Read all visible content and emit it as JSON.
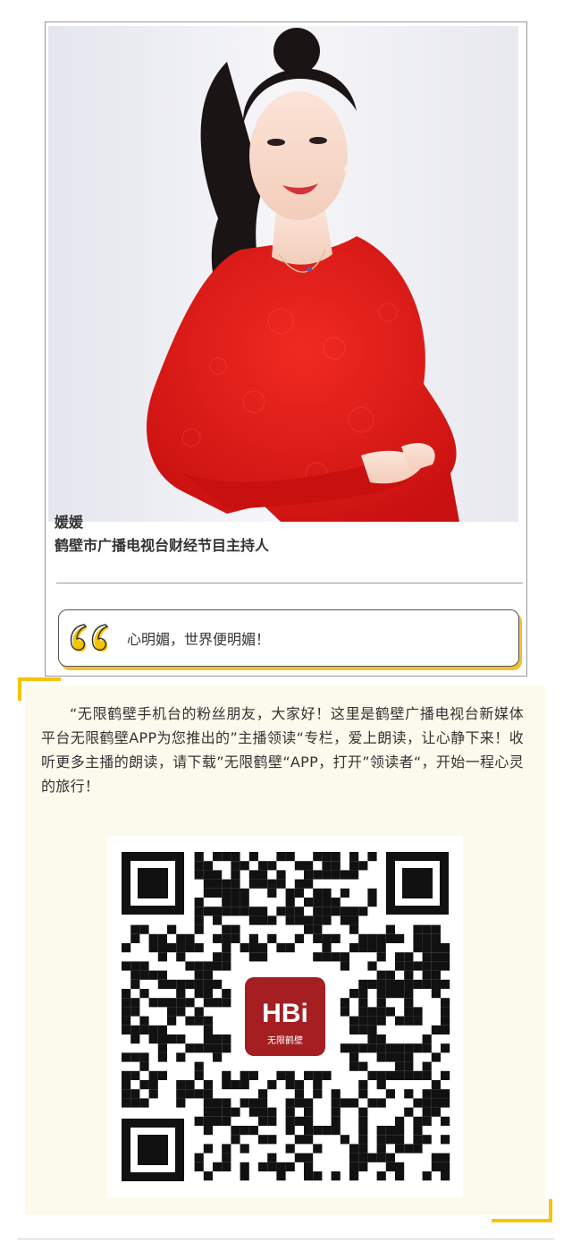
{
  "profile": {
    "name": "媛媛",
    "title": "鹤壁市广播电视台财经节目主持人",
    "quote": "心明媚，世界便明媚！"
  },
  "intro": {
    "text": "“无限鹤壁手机台的粉丝朋友，大家好！这里是鹤壁广播电视台新媒体平台无限鹤壁APP为您推出的”主播领读“专栏，爱上朗读，让心静下来！收听更多主播的朗读，请下载”无限鹤壁“APP，打开”领读者“，开始一程心灵的旅行！"
  },
  "qr": {
    "logo_text": "HBi",
    "logo_subtext": "无限鹤壁"
  },
  "colors": {
    "accent": "#f5c400",
    "quote_shadow": "#f2c12e",
    "dress": "#e21b1b",
    "logo_bg": "#a41e22",
    "intro_bg": "#fcfaec"
  },
  "icons": {
    "quote": "open-quote-icon"
  }
}
